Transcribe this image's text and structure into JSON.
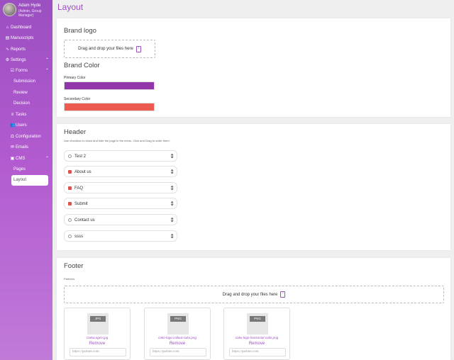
{
  "user": {
    "name": "Adam Hyde",
    "role": "(Admin, Group Manager)"
  },
  "nav": [
    {
      "label": "Dashboard",
      "icon": "home-icon",
      "glyph": "⌂"
    },
    {
      "label": "Manuscripts",
      "icon": "file-icon",
      "glyph": "▤"
    },
    {
      "label": "Reports",
      "icon": "activity-icon",
      "glyph": "∿"
    },
    {
      "label": "Settings",
      "icon": "gear-icon",
      "glyph": "⚙"
    },
    {
      "label": "Forms",
      "icon": "forms-icon",
      "glyph": "☑"
    },
    {
      "label": "Submission"
    },
    {
      "label": "Review"
    },
    {
      "label": "Decision"
    },
    {
      "label": "Tasks",
      "icon": "tasks-icon",
      "glyph": "≡"
    },
    {
      "label": "Users",
      "icon": "users-icon",
      "glyph": "👥"
    },
    {
      "label": "Configuration",
      "icon": "configuration-icon",
      "glyph": "⚖"
    },
    {
      "label": "Emails",
      "icon": "mail-icon",
      "glyph": "✉"
    },
    {
      "label": "CMS",
      "icon": "cms-icon",
      "glyph": "▣"
    },
    {
      "label": "Pages"
    },
    {
      "label": "Layout"
    }
  ],
  "page_title": "Layout",
  "brand_logo": {
    "title": "Brand logo",
    "dropzone": "Drag and drop your files here"
  },
  "brand_color": {
    "title": "Brand Color",
    "primary_label": "Primary Color",
    "primary": "#9135a9",
    "secondary_label": "Secondary Color",
    "secondary": "#ec5b50"
  },
  "header": {
    "title": "Header",
    "hint": "Use checkbox to show and hide the page in the menu. Click and Drag to order them.",
    "items": [
      {
        "label": "Test 2",
        "checked": false
      },
      {
        "label": "About us",
        "checked": true
      },
      {
        "label": "FAQ",
        "checked": true
      },
      {
        "label": "Submit",
        "checked": true
      },
      {
        "label": "Contact us",
        "checked": false
      },
      {
        "label": "ssss",
        "checked": false
      }
    ]
  },
  "footer": {
    "title": "Footer",
    "partners_label": "Partners",
    "dropzone": "Drag and drop your files here",
    "partners": [
      {
        "type": "JPG",
        "file": "CokoLogoV.jpg",
        "remove": "Remove",
        "url_placeholder": "https://partner.com"
      },
      {
        "type": "PNG",
        "file": "coko-logo-callout-color.png",
        "remove": "Remove",
        "url_placeholder": "https://partner.com"
      },
      {
        "type": "PNG",
        "file": "coko-logo-horizontal-color.png",
        "remove": "Remove",
        "url_placeholder": "https://partner.com"
      }
    ]
  }
}
